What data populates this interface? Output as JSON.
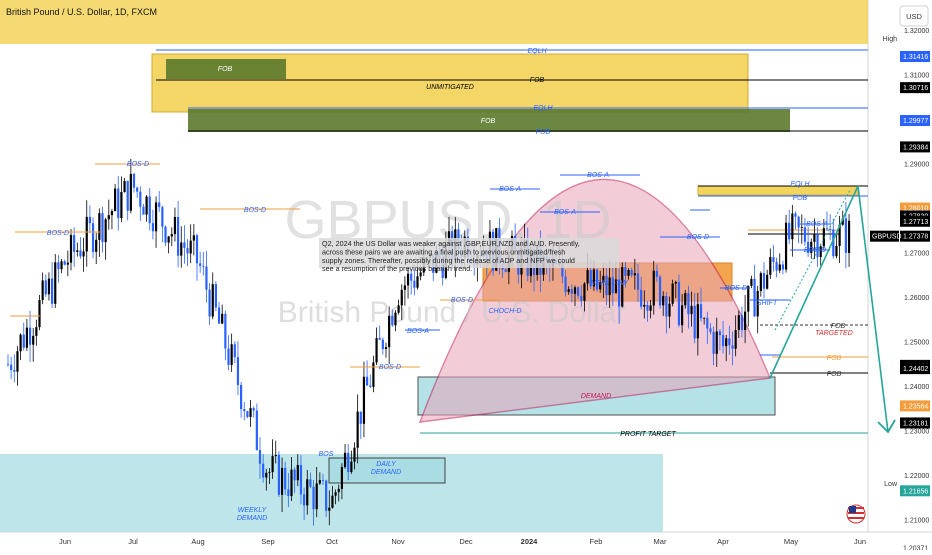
{
  "header": {
    "title": "British Pound / U.S. Dollar, 1D, FXCM",
    "currency": "USD"
  },
  "watermark": {
    "symbol": "GBPUSD, 1D",
    "name": "British Pound / U.S. Dollar"
  },
  "axis": {
    "high_label": "High",
    "low_label": "Low",
    "ticks": [
      "1.32000",
      "1.31000",
      "1.30000",
      "1.29000",
      "1.28000",
      "1.27000",
      "1.26000",
      "1.25000",
      "1.24000",
      "1.23000",
      "1.22000",
      "1.21000",
      "1.20000"
    ],
    "months": [
      "Jun",
      "Jul",
      "Aug",
      "Sep",
      "Oct",
      "Nov",
      "Dec",
      "2024",
      "Feb",
      "Mar",
      "Apr",
      "May",
      "Jun"
    ]
  },
  "price_tags": [
    {
      "value": "1.31424",
      "type": "plain"
    },
    {
      "value": "1.31416",
      "type": "blue"
    },
    {
      "value": "1.30716",
      "type": "black"
    },
    {
      "value": "1.29977",
      "type": "blue"
    },
    {
      "value": "1.29384",
      "type": "black"
    },
    {
      "value": "1.28010",
      "type": "orange"
    },
    {
      "value": "1.27833",
      "type": "blue"
    },
    {
      "value": "1.27830",
      "type": "black"
    },
    {
      "value": "1.27713",
      "type": "black"
    },
    {
      "value": "1.27378",
      "type": "black"
    },
    {
      "value": "1.24475",
      "type": "darkgreen"
    },
    {
      "value": "1.24473",
      "type": "black"
    },
    {
      "value": "1.24402",
      "type": "black"
    },
    {
      "value": "1.23564",
      "type": "orange"
    },
    {
      "value": "1.23181",
      "type": "black"
    },
    {
      "value": "1.21656",
      "type": "teal"
    },
    {
      "value": "1.20371",
      "type": "plain"
    }
  ],
  "symbol_tag": "GBPUSD",
  "annotations": {
    "note": "Q2, 2024 the US Dollar was weaker against ,GBP,EUR,NZD and AUD. Presently, across these pairs we are awaiting a final push to previous unmitigated/fresh supply zones. Thereafter, possibly during the release of ADP and NFP we could see a resumption of the previous bearish trend.",
    "fob": "FOB",
    "eqlh": "EQLH",
    "unmitigated": "UNMITIGATED",
    "fob_2": "FOB",
    "eqlh_2": "EQLH",
    "fob_3": "FOB",
    "fob_4": "FOB",
    "bos_d": "BOS-D",
    "bos_d_2": "BOS-D",
    "bos_d_3": "BOS-D",
    "bos_d_4": "BOS-D",
    "bos_d_5": "BOS-D",
    "bos_a": "BOS-A",
    "bos_a_2": "BOS-A",
    "bos_a_3": "BOS-A",
    "bos_a_4": "BOS-A",
    "bos_a_5": "BOS-A",
    "bos_d_6": "BOS-D",
    "bos_d_7": "BOS-D",
    "bos_d_8": "BOS-D",
    "choch_d": "CHOCH-D",
    "weak_low": "WEAK LOW",
    "eqlh_3": "EQLH",
    "fob_5": "FOB",
    "shift": "SHIFT",
    "fob_6": "FOB",
    "targeted": "TARGETED",
    "fob_7": "FOB",
    "fob_8": "FOB",
    "demand": "DEMAND",
    "profit_target": "PROFIT TARGET",
    "daily_demand": "DAILY\nDEMAND",
    "weekly_demand": "WEEKLY\nDEMAND",
    "bos_small": "BOS"
  },
  "colors": {
    "yellow_zone": "#f2d04c",
    "green_zone": "#5b7a2e",
    "orange_zone": "#f39c3b",
    "pink_zone": "#e8a5b8",
    "teal_zone": "#a8dde3",
    "bull_candle": "#000000",
    "bear_candle": "#2962ff",
    "accent_blue": "#2962ff",
    "teal_line": "#26a69a",
    "red_label": "#d32f2f"
  },
  "chart_data": {
    "type": "candlestick",
    "title": "British Pound / U.S. Dollar, 1D, FXCM",
    "ylim": [
      1.1985,
      1.3205
    ],
    "y_ticks": [
      1.32,
      1.31,
      1.3,
      1.29,
      1.28,
      1.27,
      1.26,
      1.25,
      1.24,
      1.23,
      1.22,
      1.21,
      1.2
    ],
    "x_months": [
      "Jun",
      "Jul",
      "Aug",
      "Sep",
      "Oct",
      "Nov",
      "Dec",
      "2024",
      "Feb",
      "Mar",
      "Apr",
      "May",
      "Jun"
    ],
    "close_path_monthly": [
      {
        "month": "May 2023",
        "close": 1.245
      },
      {
        "month": "Jun",
        "close": 1.268
      },
      {
        "month": "Jul",
        "close": 1.285
      },
      {
        "month": "Aug",
        "close": 1.268
      },
      {
        "month": "Sep",
        "close": 1.221
      },
      {
        "month": "Oct",
        "close": 1.214
      },
      {
        "month": "Nov",
        "close": 1.262
      },
      {
        "month": "Dec",
        "close": 1.273
      },
      {
        "month": "Jan",
        "close": 1.268
      },
      {
        "month": "Feb",
        "close": 1.262
      },
      {
        "month": "Mar",
        "close": 1.262
      },
      {
        "month": "Apr",
        "close": 1.249
      },
      {
        "month": "May",
        "close": 1.274
      }
    ],
    "last_price": 1.27378,
    "high": 1.31424,
    "low": 1.20371,
    "zones": [
      {
        "label": "FOB",
        "top": 1.3142,
        "bottom": 1.3,
        "color": "yellow"
      },
      {
        "label": "FOB",
        "top": 1.2998,
        "bottom": 1.2938,
        "color": "green"
      },
      {
        "label": "DEMAND",
        "top": 1.2318,
        "bottom": 1.2225,
        "color": "teal"
      },
      {
        "label": "WEEKLY DEMAND",
        "top": 1.212,
        "bottom": 1.1985,
        "color": "teal"
      },
      {
        "label": "FOB",
        "top": 1.26,
        "bottom": 1.2505,
        "color": "orange"
      }
    ],
    "profit_target": 1.21656
  }
}
